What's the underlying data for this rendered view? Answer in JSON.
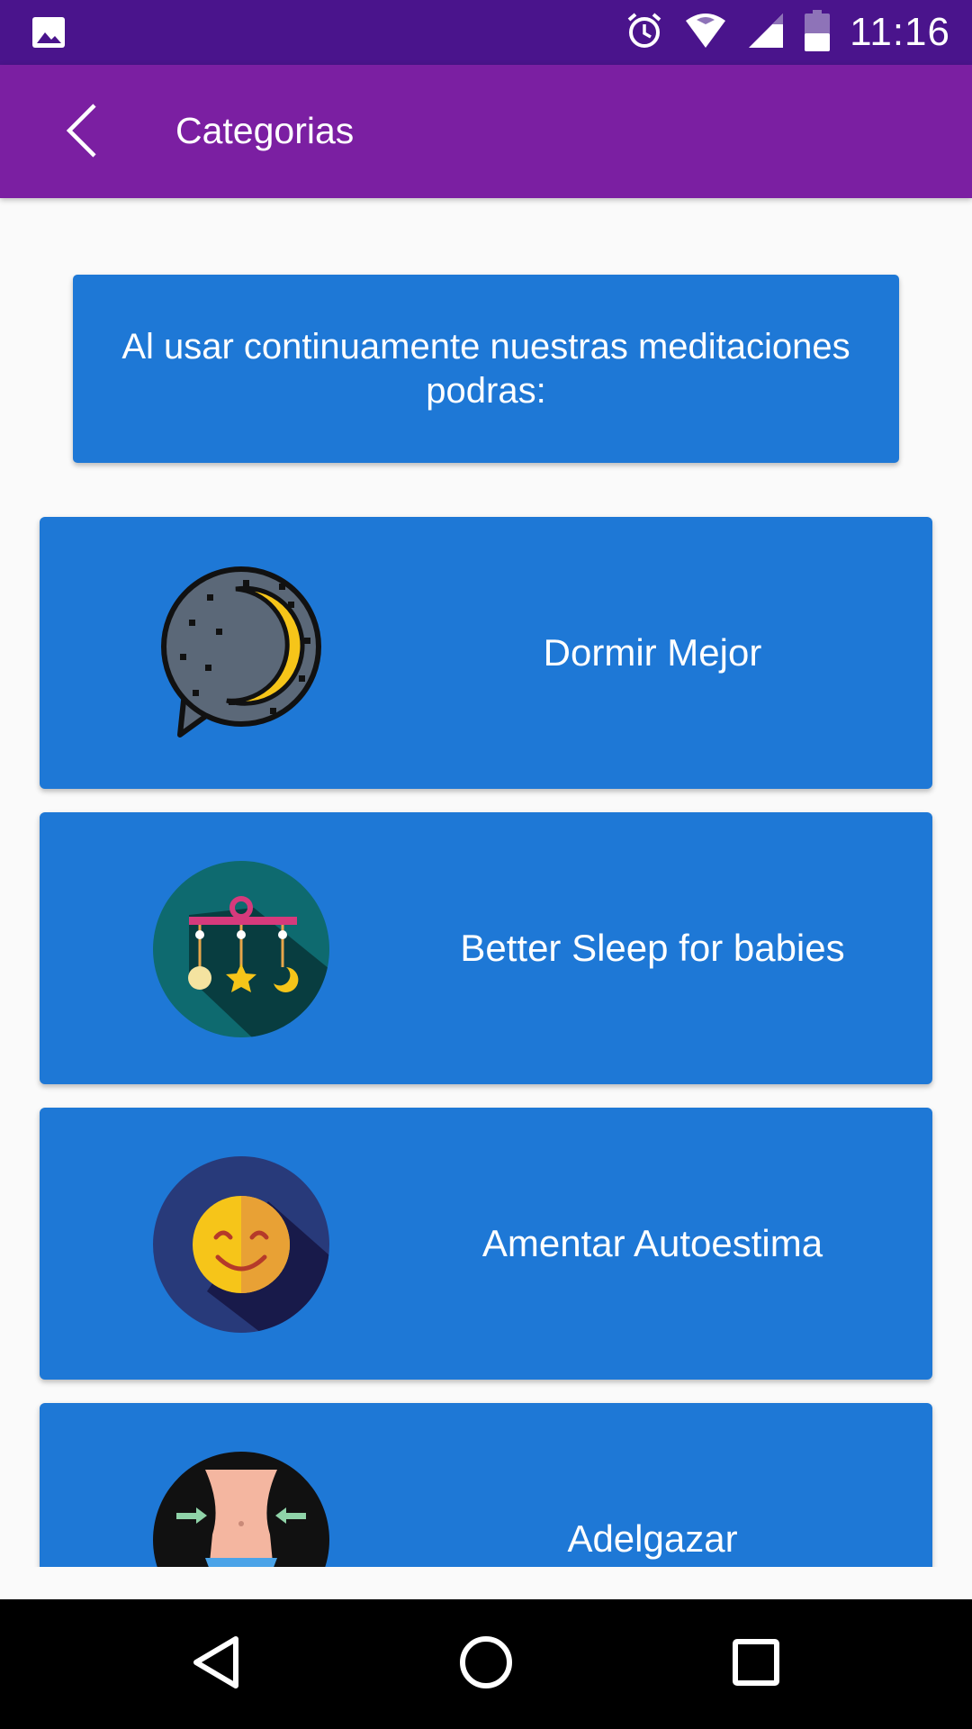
{
  "status_bar": {
    "time": "11:16",
    "icons": [
      "image-icon",
      "alarm-icon",
      "wifi-icon",
      "signal-icon",
      "battery-icon"
    ]
  },
  "app_bar": {
    "title": "Categorias",
    "back_icon": "chevron-left-icon"
  },
  "banner": {
    "text": "Al usar continuamente nuestras meditaciones podras:"
  },
  "categories": [
    {
      "label": "Dormir Mejor",
      "icon": "moon-chat-icon"
    },
    {
      "label": "Better Sleep for babies",
      "icon": "baby-mobile-icon"
    },
    {
      "label": "Amentar Autoestima",
      "icon": "smiley-icon"
    },
    {
      "label": "Adelgazar",
      "icon": "waist-icon"
    }
  ],
  "nav_bar": {
    "icons": [
      "back-triangle-icon",
      "home-circle-icon",
      "recents-square-icon"
    ]
  },
  "colors": {
    "status_bar": "#4a148c",
    "app_bar": "#7b1fa2",
    "card": "#1e78d6",
    "background": "#fafafa"
  }
}
